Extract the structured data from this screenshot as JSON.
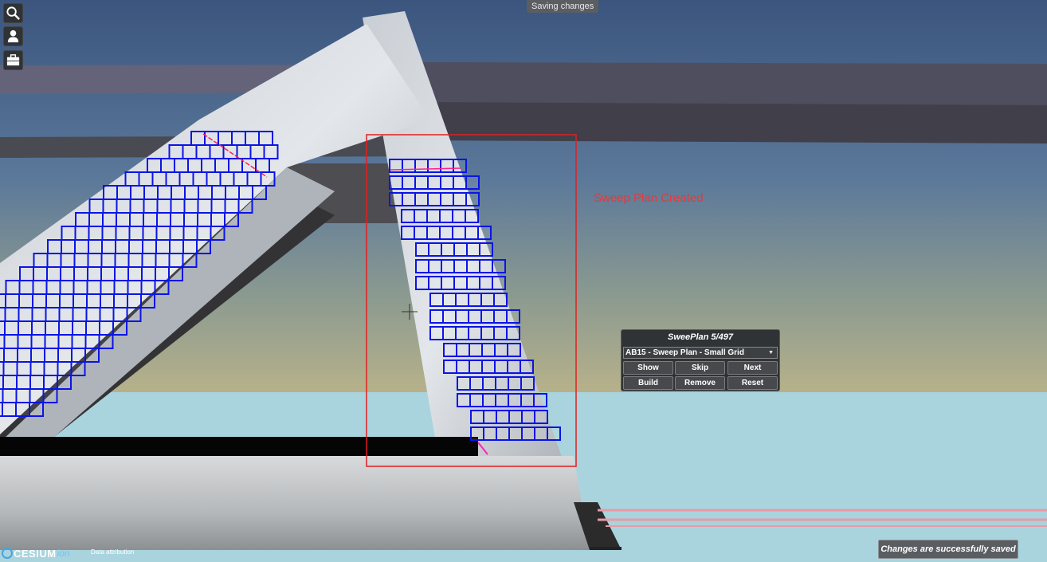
{
  "toolbar": {
    "search_icon": "search-icon",
    "user_icon": "user-icon",
    "briefcase_icon": "briefcase-icon"
  },
  "status_top": "Saving changes",
  "overlay_label": "Sweep Plan Created",
  "panel": {
    "title": "SweePlan 5/497",
    "select_value": "AB15 - Sweep Plan - Small Grid",
    "buttons": {
      "show": "Show",
      "skip": "Skip",
      "next": "Next",
      "build": "Build",
      "remove": "Remove",
      "reset": "Reset"
    }
  },
  "toast": "Changes are successfully saved",
  "footer": {
    "logo_text": "CESIUM",
    "logo_suffix": "ion",
    "attribution": "Data attribution"
  },
  "colors": {
    "grid": "#0a14e6",
    "selection": "#e02020",
    "label": "#e53a3a"
  }
}
